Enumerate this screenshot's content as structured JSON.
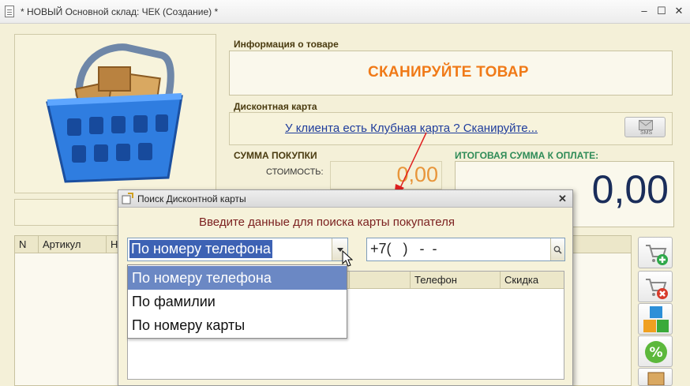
{
  "window": {
    "title": "* НОВЫЙ Основной склад: ЧЕК (Создание) *"
  },
  "product_info": {
    "group_title": "Информация о товаре",
    "scan_prompt": "СКАНИРУЙТЕ ТОВАР"
  },
  "discount_card": {
    "group_title": "Дисконтная карта",
    "link_text": "У клиента есть Клубная карта ? Сканируйте...",
    "sms_button_label": "SMS"
  },
  "purchase_sum": {
    "group_title": "СУММА ПОКУПКИ",
    "cost_label": "СТОИМОСТЬ:",
    "cost_value": "0,00"
  },
  "total_sum": {
    "group_title": "ИТОГОВАЯ СУММА К ОПЛАТЕ:",
    "value": "0,00"
  },
  "items_table": {
    "columns": [
      "N",
      "Артикул",
      "Но"
    ]
  },
  "dialog": {
    "title": "Поиск Дисконтной карты",
    "prompt": "Введите данные для поиска карты покупателя",
    "search_mode": {
      "selected": "По номеру телефона",
      "options": [
        "По номеру телефона",
        "По фамилии",
        "По номеру карты"
      ]
    },
    "phone_input_value": "+7(   )   -  -",
    "results_columns": [
      "Телефон",
      "Скидка"
    ]
  },
  "colors": {
    "accent_orange": "#f07a18",
    "link_blue": "#1e3c9c",
    "selection_blue": "#3d62b4",
    "total_green_title": "#2e8b57"
  }
}
